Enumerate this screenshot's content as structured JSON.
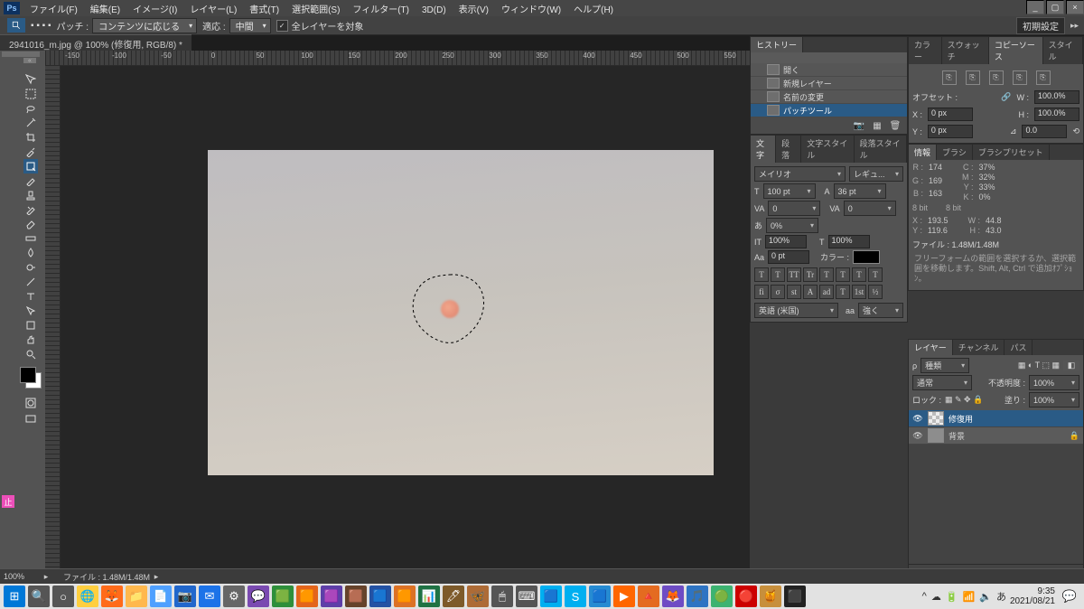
{
  "menu": {
    "items": [
      "ファイル(F)",
      "編集(E)",
      "イメージ(I)",
      "レイヤー(L)",
      "書式(T)",
      "選択範囲(S)",
      "フィルター(T)",
      "3D(D)",
      "表示(V)",
      "ウィンドウ(W)",
      "ヘルプ(H)"
    ]
  },
  "window": {
    "min": "_",
    "restore": "▢",
    "close": "×"
  },
  "options_bar": {
    "patch_label": "パッチ :",
    "patch_mode": "コンテンツに応じる",
    "adapt_label": "適応 :",
    "adapt_value": "中間",
    "all_layers": "全レイヤーを対象",
    "screen_mode": "初期設定"
  },
  "document_tab": "2941016_m.jpg @ 100% (修復用, RGB/8) *",
  "ruler_numbers": [
    -150,
    -100,
    -50,
    0,
    50,
    100,
    150,
    200,
    250,
    300,
    350,
    400,
    450,
    500,
    550
  ],
  "status": {
    "zoom": "100%",
    "doc": "ファイル : 1.48M/1.48M"
  },
  "history": {
    "tab": "ヒストリー",
    "items": [
      "開く",
      "新規レイヤー",
      "名前の変更",
      "パッチツール"
    ],
    "selected": 3
  },
  "character": {
    "tabs": [
      "文字",
      "段落",
      "文字スタイル",
      "段落スタイル"
    ],
    "font": "メイリオ",
    "style": "レギュ...",
    "size": "100 pt",
    "leading": "36 pt",
    "va": "0",
    "tracking": "0",
    "az": "0%",
    "scale_v": "100%",
    "scale_h": "100%",
    "baseline": "0 pt",
    "color_label": "カラー :",
    "toggles": [
      "T",
      "T",
      "TT",
      "Tr",
      "T",
      "T",
      "T",
      "T"
    ],
    "kern_toggles": [
      "fi",
      "σ",
      "st",
      "A",
      "ad",
      "T",
      "1st",
      "½"
    ],
    "lang": "英語 (米国)",
    "aa_label": "aa",
    "aa": "強く"
  },
  "color_tabs": [
    "カラー",
    "スウォッチ",
    "コピーソース",
    "スタイル"
  ],
  "copy_source": {
    "offset_label": "オフセット :",
    "w_label": "W :",
    "w": "100.0%",
    "x_label": "X :",
    "x": "0 px",
    "h_label": "H :",
    "h": "100.0%",
    "y_label": "Y :",
    "y": "0 px",
    "rot": "0.0"
  },
  "info": {
    "tabs": [
      "情報",
      "ブラシ",
      "ブラシプリセット"
    ],
    "R": "174",
    "G": "169",
    "B": "163",
    "bit1": "8 bit",
    "C": "37%",
    "M": "32%",
    "Y": "33%",
    "K": "0%",
    "bit2": "8 bit",
    "X": "193.5",
    "Yc": "119.6",
    "W": "44.8",
    "H": "43.0",
    "file": "ファイル : 1.48M/1.48M",
    "hint": "フリーフォームの範囲を選択するか、選択範囲を移動します。Shift, Alt, Ctrl で追加ｵﾌﾟｼｮﾝ。"
  },
  "layers": {
    "tabs": [
      "レイヤー",
      "チャンネル",
      "パス"
    ],
    "kind": "種類",
    "mode": "通常",
    "opacity_label": "不透明度 :",
    "opacity": "100%",
    "lock_label": "ロック :",
    "fill_label": "塗り :",
    "fill": "100%",
    "rows": [
      {
        "name": "修復用",
        "selected": true,
        "checker": true
      },
      {
        "name": "背景",
        "selected": false,
        "checker": false
      }
    ]
  },
  "taskbar": {
    "items": [
      "⊞",
      "🔍",
      "○",
      "🌐",
      "🦊",
      "📁",
      "📄",
      "📷",
      "✉",
      "⚙",
      "💬",
      "🟩",
      "🟧",
      "🟪",
      "🟫",
      "🟦",
      "🟧",
      "📊",
      "🖊",
      "🦋",
      "🖱",
      "⌨",
      "🟦",
      "S",
      "🟦",
      "▶",
      "🔺",
      "🦊",
      "🎵",
      "🟢",
      "🔴",
      "🍯",
      "⬛"
    ],
    "tray": [
      "^",
      "☁",
      "🔋",
      "📶",
      "🔈",
      "あ"
    ],
    "time": "9:35",
    "date": "2021/08/21"
  }
}
